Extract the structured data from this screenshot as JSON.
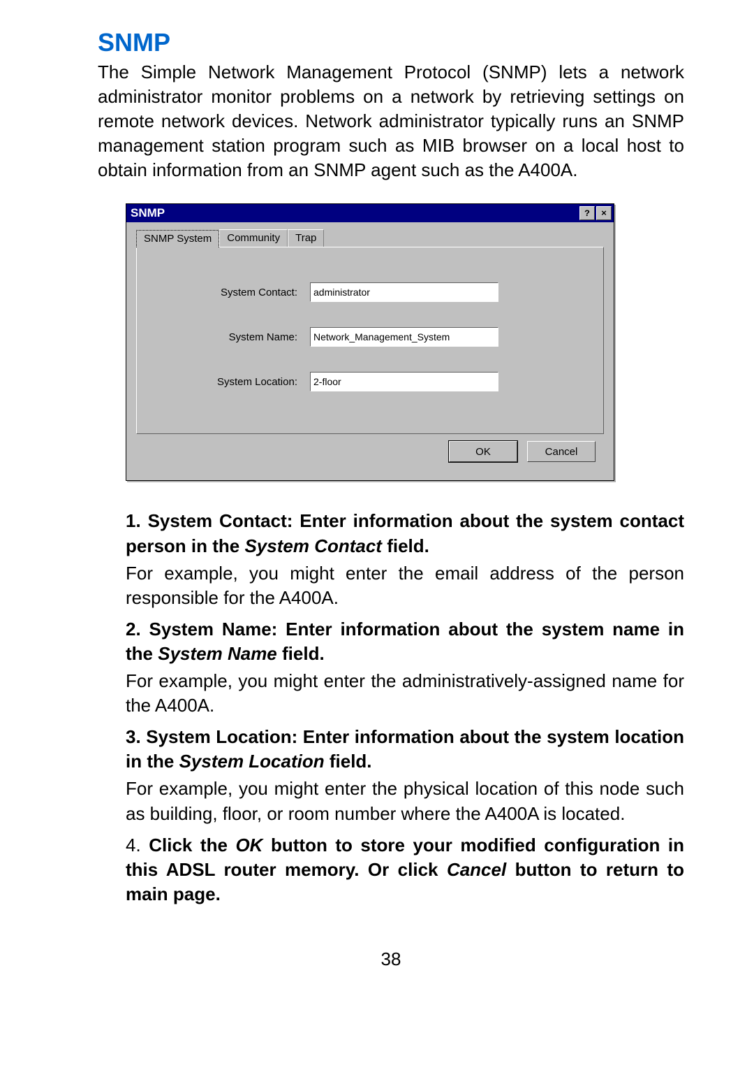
{
  "heading": "SNMP",
  "intro": "The Simple Network Management Protocol (SNMP) lets a network administrator monitor problems on a network by retrieving settings on remote network devices.  Network administrator typically runs an SNMP management station program such as MIB browser on a local host to obtain information from an SNMP agent such as the A400A.",
  "dialog": {
    "title": "SNMP",
    "help_glyph": "?",
    "close_glyph": "×",
    "tabs": {
      "snmp_system": "SNMP System",
      "community": "Community",
      "trap": "Trap"
    },
    "labels": {
      "system_contact": "System Contact:",
      "system_name": "System Name:",
      "system_location": "System Location:"
    },
    "values": {
      "system_contact": "administrator",
      "system_name": "Network_Management_System",
      "system_location": "2-floor"
    },
    "buttons": {
      "ok": "OK",
      "cancel": "Cancel"
    }
  },
  "list": {
    "item1_marker": "1.",
    "item1_lead_a": "System Contact: Enter information about the system contact person in the ",
    "item1_em": "System Contact",
    "item1_lead_b": " field.",
    "item1_sub": "For example, you might enter the email address of the person responsible for the A400A.",
    "item2_marker": "2.",
    "item2_lead_a": "System Name: Enter information about the system name in the ",
    "item2_em": "System Name",
    "item2_lead_b": " field.",
    "item2_sub": "For example, you might enter the administratively-assigned name for the  A400A.",
    "item3_marker": "3.",
    "item3_lead_a": "System Location: Enter information about the system location in the ",
    "item3_em": "System Location",
    "item3_lead_b": " field.",
    "item3_sub": "For example, you might enter the physical location of this node such as building, floor, or room number where the A400A is located.",
    "item4_marker": "4.",
    "item4_lead_a": "Click the ",
    "item4_em1": "OK",
    "item4_lead_b": " button to store your modified configuration in this ADSL router memory.  Or click ",
    "item4_em2": "Cancel",
    "item4_lead_c": " button to return to main page."
  },
  "page_number": "38"
}
